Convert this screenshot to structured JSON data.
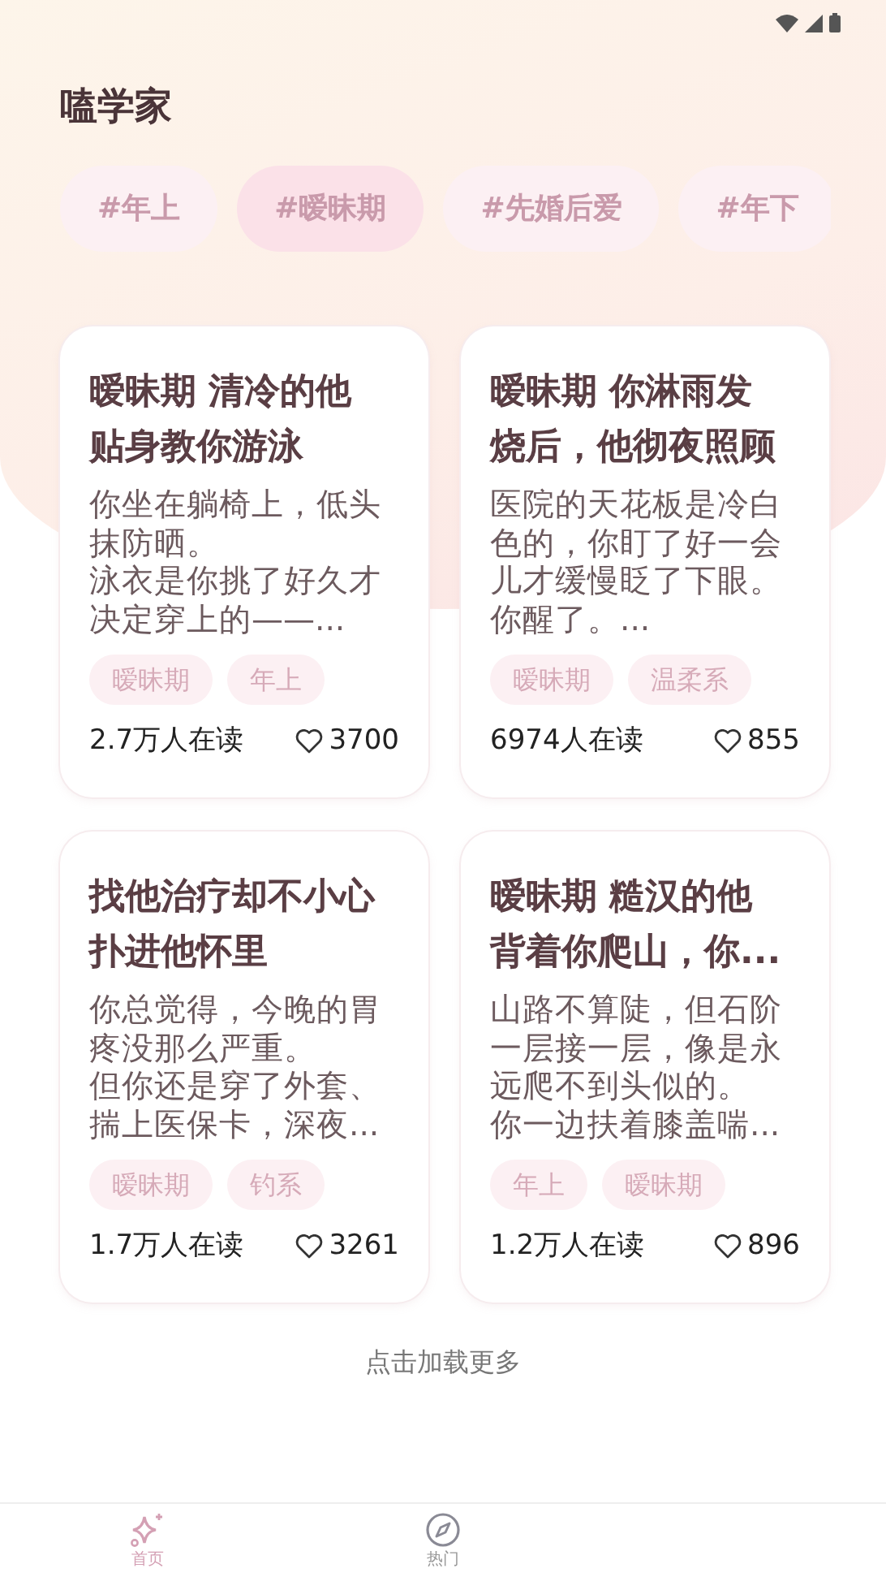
{
  "app_title": "嗑学家",
  "topics": [
    {
      "label": "#年上",
      "selected": false
    },
    {
      "label": "#暧昧期",
      "selected": true
    },
    {
      "label": "#先婚后爱",
      "selected": false
    },
    {
      "label": "#年下",
      "selected": false
    }
  ],
  "stories": [
    {
      "title": "暧昧期 清冷的他贴身教你游泳",
      "excerpt": [
        "你坐在躺椅上，低头抹防晒。",
        "泳衣是你挑了好久才决定穿上的——..."
      ],
      "tags": [
        "暧昧期",
        "年上"
      ],
      "readers": "2.7万人在读",
      "likes": "3700"
    },
    {
      "title": "暧昧期 你淋雨发烧后，他彻夜照顾",
      "excerpt": [
        "医院的天花板是冷白色的，你盯了好一会儿才缓慢眨了下眼。",
        "你醒了。..."
      ],
      "tags": [
        "暧昧期",
        "温柔系"
      ],
      "readers": "6974人在读",
      "likes": "855"
    },
    {
      "title": "找他治疗却不小心扑进他怀里",
      "excerpt": [
        "你总觉得，今晚的胃疼没那么严重。",
        "但你还是穿了外套、揣上医保卡，深夜..."
      ],
      "tags": [
        "暧昧期",
        "钓系"
      ],
      "readers": "1.7万人在读",
      "likes": "3261"
    },
    {
      "title": "暧昧期 糙汉的他背着你爬山，你...",
      "excerpt": [
        "山路不算陡，但石阶一层接一层，像是永远爬不到头似的。",
        "你一边扶着膝盖喘..."
      ],
      "tags": [
        "年上",
        "暧昧期"
      ],
      "readers": "1.2万人在读",
      "likes": "896"
    }
  ],
  "load_more": "点击加载更多",
  "bottom_nav": [
    {
      "kind": "sparkle",
      "label": "首页",
      "selected": true
    },
    {
      "kind": "compass",
      "label": "热门",
      "selected": false
    }
  ]
}
